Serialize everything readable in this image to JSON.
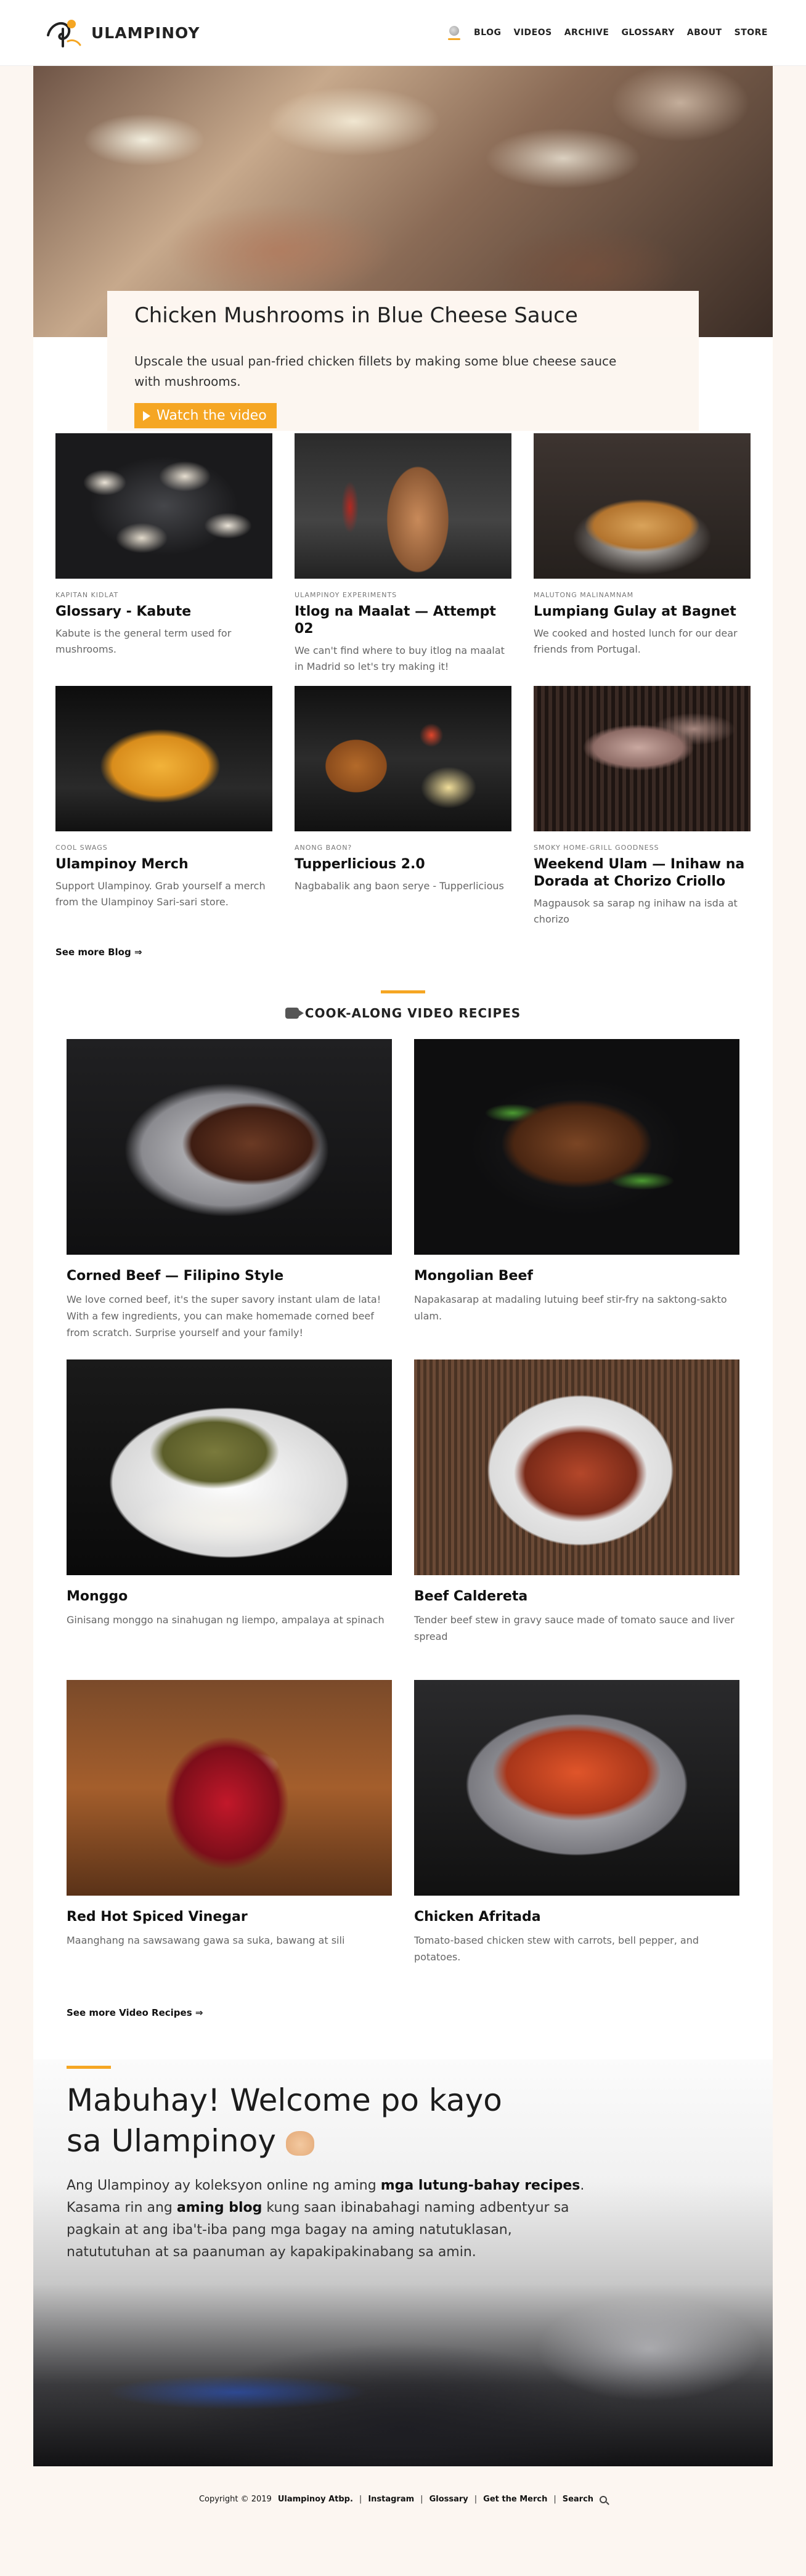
{
  "header": {
    "logo_text": "ULAMPINOY",
    "nav": [
      "BLOG",
      "VIDEOS",
      "ARCHIVE",
      "GLOSSARY",
      "ABOUT",
      "STORE"
    ]
  },
  "hero": {
    "title": "Chicken Mushrooms in Blue Cheese Sauce",
    "description": "Upscale the usual pan-fried chicken fillets by making some blue cheese sauce with mushrooms.",
    "button_label": "Watch the video"
  },
  "blog": {
    "items": [
      {
        "category": "KAPITAN KIDLAT",
        "title": "Glossary - Kabute",
        "desc": "Kabute is the general term used for mushrooms."
      },
      {
        "category": "ULAMPINOY EXPERIMENTS",
        "title": "Itlog na Maalat — Attempt 02",
        "desc": "We can't find where to buy itlog na maalat in Madrid so let's try making it!"
      },
      {
        "category": "MALUTONG MALINAMNAM",
        "title": "Lumpiang Gulay at Bagnet",
        "desc": "We cooked and hosted lunch for our dear friends from Portugal."
      },
      {
        "category": "COOL SWAGS",
        "title": "Ulampinoy Merch",
        "desc": "Support Ulampinoy. Grab yourself a merch from the Ulampinoy Sari-sari store."
      },
      {
        "category": "ANONG BAON?",
        "title": "Tupperlicious 2.0",
        "desc": "Nagbabalik ang baon serye - Tupperlicious"
      },
      {
        "category": "SMOKY HOME-GRILL GOODNESS",
        "title": "Weekend Ulam — Inihaw na Dorada at Chorizo Criollo",
        "desc": "Magpausok sa sarap ng inihaw na isda at chorizo"
      }
    ],
    "see_more": "See more Blog ⇒"
  },
  "videos": {
    "heading": "COOK-ALONG VIDEO RECIPES",
    "items": [
      {
        "title": "Corned Beef — Filipino Style",
        "desc": "We love corned beef, it's the super savory instant ulam de lata! With a few ingredients, you can make homemade corned beef from scratch. Surprise yourself and your family!"
      },
      {
        "title": "Mongolian Beef",
        "desc": "Napakasarap at madaling lutuing beef stir-fry na saktong-sakto ulam."
      },
      {
        "title": "Monggo",
        "desc": "Ginisang monggo na sinahugan ng liempo, ampalaya at spinach"
      },
      {
        "title": "Beef Caldereta",
        "desc": "Tender beef stew in gravy sauce made of tomato sauce and liver spread"
      },
      {
        "title": "Red Hot Spiced Vinegar",
        "desc": "Maanghang na sawsawang gawa sa suka, bawang at sili"
      },
      {
        "title": "Chicken Afritada",
        "desc": "Tomato-based chicken stew with carrots, bell pepper, and potatoes."
      }
    ],
    "see_more": "See more Video Recipes ⇒"
  },
  "welcome": {
    "title": "Mabuhay! Welcome po kayo sa Ulampinoy",
    "text_1": "Ang Ulampinoy ay koleksyon online ng aming ",
    "bold_1": "mga lutung-bahay recipes",
    "text_2": ". Kasama rin ang ",
    "bold_2": "aming blog",
    "text_3": " kung saan ibinabahagi naming adbentyur sa pagkain at ang iba't-iba pang mga bagay na aming natutuklasan, natututuhan at sa paanuman ay kapakipakinabang sa amin."
  },
  "footer": {
    "copyright": "Copyright © 2019",
    "brand": "Ulampinoy Atbp.",
    "links": [
      "Instagram",
      "Glossary",
      "Get the Merch",
      "Search"
    ]
  },
  "colors": {
    "accent": "#f5a623",
    "background": "#fcf6f1"
  }
}
